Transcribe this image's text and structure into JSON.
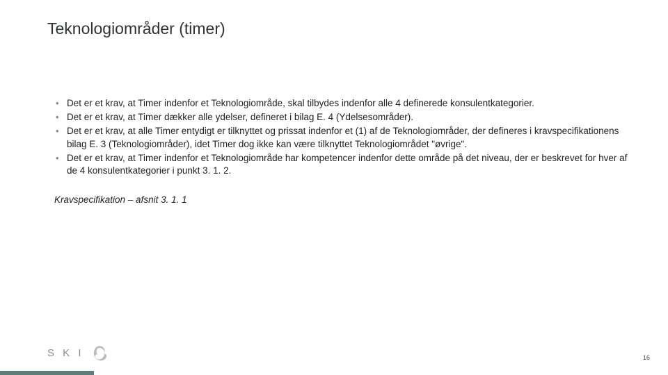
{
  "title": "Teknologiområder (timer)",
  "bullets": [
    "Det er et krav, at Timer indenfor et Teknologiområde, skal tilbydes indenfor alle 4 definerede konsulentkategorier.",
    "Det er et krav, at Timer dækker alle ydelser, defineret i bilag E. 4 (Ydelsesområder).",
    "Det er et krav, at alle Timer entydigt er tilknyttet og prissat indenfor et (1) af de Teknologiområder, der defineres i kravspecifikationens bilag E. 3 (Teknologiområder), idet Timer dog ikke kan være tilknyttet Teknologiområdet \"øvrige\".",
    "Det er et krav, at Timer indenfor et Teknologiområde har kompetencer indenfor dette område på det niveau, der er beskrevet for hver af de 4 konsulentkategorier i punkt 3. 1. 2."
  ],
  "caption": "Kravspecifikation – afsnit 3. 1. 1",
  "logo_text": "S K I",
  "page_number": "16"
}
